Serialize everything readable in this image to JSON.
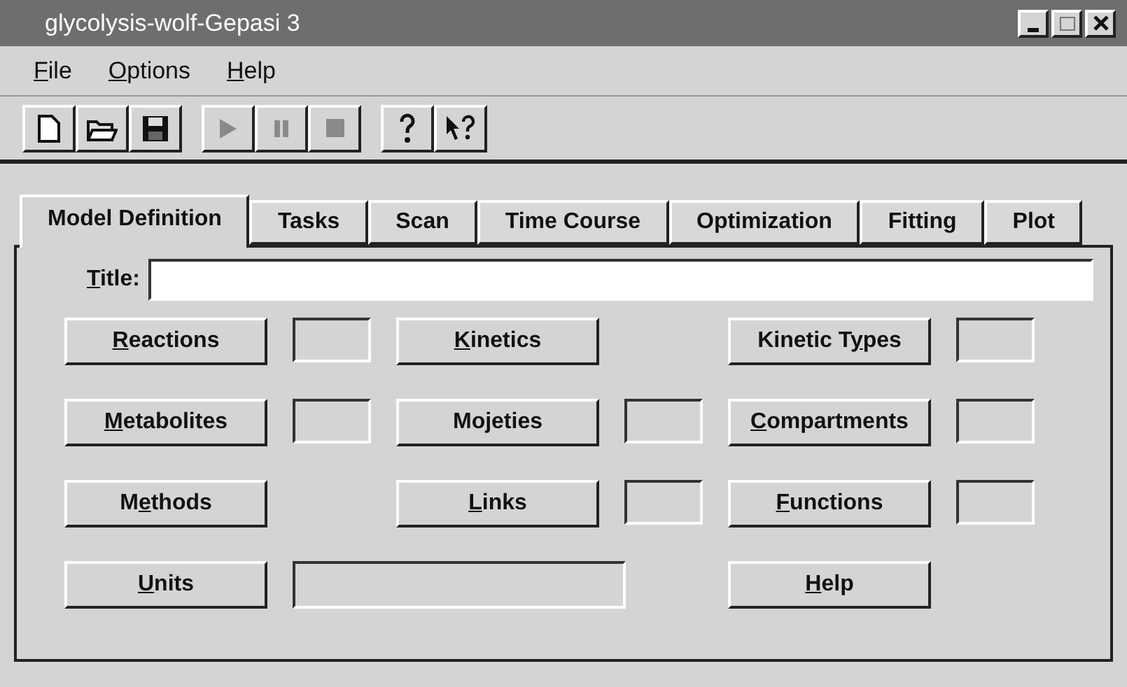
{
  "window": {
    "title": "glycolysis-wolf-Gepasi 3"
  },
  "menu": [
    {
      "key": "F",
      "post": "ile"
    },
    {
      "key": "O",
      "post": "ptions"
    },
    {
      "key": "H",
      "post": "elp"
    }
  ],
  "toolbar": [
    {
      "kind": "new",
      "disabled": false
    },
    {
      "kind": "open",
      "disabled": false
    },
    {
      "kind": "save",
      "disabled": false
    },
    {
      "kind": "play",
      "disabled": true
    },
    {
      "kind": "pause",
      "disabled": true
    },
    {
      "kind": "stop",
      "disabled": true
    },
    {
      "kind": "help",
      "disabled": false
    },
    {
      "kind": "context-help",
      "disabled": false
    }
  ],
  "tabs": [
    {
      "label": "Model Definition",
      "selected": true
    },
    {
      "label": "Tasks",
      "selected": false
    },
    {
      "label": "Scan",
      "selected": false
    },
    {
      "label": "Time Course",
      "selected": false
    },
    {
      "label": "Optimization",
      "selected": false
    },
    {
      "label": "Fitting",
      "selected": false
    },
    {
      "label": "Plot",
      "selected": false
    }
  ],
  "title_field": {
    "label": {
      "key": "T",
      "post": "itle:"
    }
  },
  "rows": [
    [
      {
        "label": {
          "key": "R",
          "post": "eactions"
        },
        "kind": "small"
      },
      {
        "label": {
          "key": "K",
          "post": "inetics"
        },
        "kind": "none"
      },
      {
        "label": {
          "pre": "Kinetic T",
          "key": "y",
          "post": "pes"
        },
        "kind": "small"
      }
    ],
    [
      {
        "label": {
          "key": "M",
          "post": "etabolites"
        },
        "kind": "small"
      },
      {
        "label": {
          "pre": "Mojeties"
        },
        "kind": "small"
      },
      {
        "label": {
          "key": "C",
          "post": "ompartments"
        },
        "kind": "small"
      }
    ],
    [
      {
        "label": {
          "pre": "M",
          "key": "e",
          "post": "thods"
        },
        "kind": "none"
      },
      {
        "label": {
          "key": "L",
          "post": "inks"
        },
        "kind": "small"
      },
      {
        "label": {
          "key": "F",
          "post": "unctions"
        },
        "kind": "small"
      }
    ],
    [
      {
        "label": {
          "key": "U",
          "post": "nits"
        },
        "kind": "wide"
      },
      {
        "label": {
          "key": "H",
          "post": "elp"
        },
        "kind": "none"
      }
    ]
  ]
}
